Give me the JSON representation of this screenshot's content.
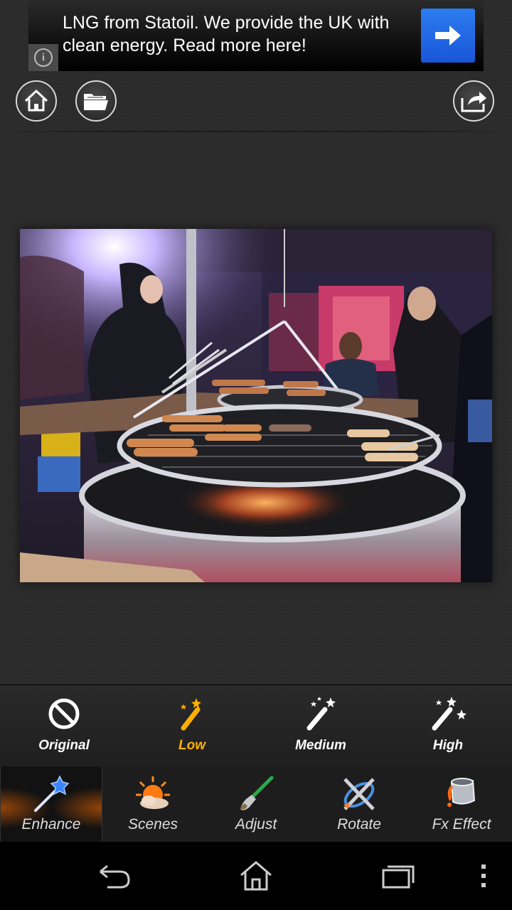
{
  "ad": {
    "text": "LNG from Statoil. We provide the UK with clean energy. Read more here!",
    "info_icon": "info-icon",
    "arrow_icon": "arrow-right-icon",
    "arrow_color": "#1f66e0"
  },
  "toolbar": {
    "home_icon": "home-icon",
    "folder_icon": "folder-icon",
    "share_icon": "share-icon"
  },
  "photo": {
    "description_icon": "photo-preview"
  },
  "enhance_levels": [
    {
      "label": "Original",
      "icon": "no-icon",
      "active": false
    },
    {
      "label": "Low",
      "icon": "magic-wand-icon",
      "active": true
    },
    {
      "label": "Medium",
      "icon": "magic-wand-icon",
      "active": false
    },
    {
      "label": "High",
      "icon": "magic-wand-icon",
      "active": false
    }
  ],
  "tabs": [
    {
      "label": "Enhance",
      "icon": "wand-icon",
      "active": true
    },
    {
      "label": "Scenes",
      "icon": "sun-cloud-icon",
      "active": false
    },
    {
      "label": "Adjust",
      "icon": "brush-icon",
      "active": false
    },
    {
      "label": "Rotate",
      "icon": "rotate-icon",
      "active": false
    },
    {
      "label": "Fx Effect",
      "icon": "paint-bucket-icon",
      "active": false
    }
  ],
  "colors": {
    "accent": "#ffb000",
    "tab_glow": "#ff6e00"
  },
  "navbar": {
    "back_icon": "back-icon",
    "home_icon": "nav-home-icon",
    "recents_icon": "recents-icon",
    "menu_icon": "overflow-menu-icon"
  }
}
